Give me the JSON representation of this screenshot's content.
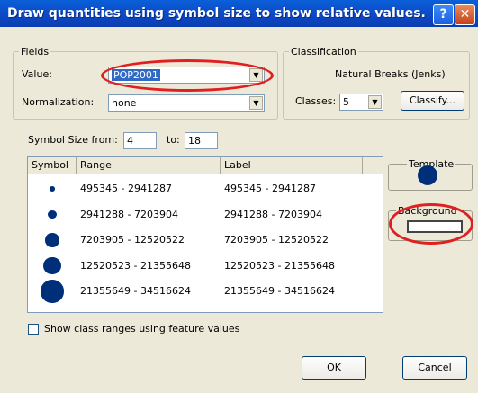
{
  "window": {
    "title": "Draw quantities using symbol size to show relative values.",
    "help_label": "?",
    "close_label": "✕"
  },
  "fields": {
    "legend": "Fields",
    "value_label": "Value:",
    "value_selected": "POP2001",
    "normalization_label": "Normalization:",
    "normalization_selected": "none"
  },
  "classification": {
    "legend": "Classification",
    "method": "Natural Breaks (Jenks)",
    "classes_label": "Classes:",
    "classes_value": "5",
    "classify_button": "Classify..."
  },
  "symbol_size": {
    "from_label": "Symbol Size from:",
    "from_value": "4",
    "to_label": "to:",
    "to_value": "18"
  },
  "table": {
    "columns": [
      "Symbol",
      "Range",
      "Label"
    ],
    "rows": [
      {
        "range": "495345 - 2941287",
        "label": "495345 - 2941287",
        "symbol_size": 4
      },
      {
        "range": "2941288 - 7203904",
        "label": "2941288 - 7203904",
        "symbol_size": 7
      },
      {
        "range": "7203905 - 12520522",
        "label": "7203905 - 12520522",
        "symbol_size": 11
      },
      {
        "range": "12520523 - 21355648",
        "label": "12520523 - 21355648",
        "symbol_size": 14
      },
      {
        "range": "21355649 - 34516624",
        "label": "21355649 - 34516624",
        "symbol_size": 18
      }
    ]
  },
  "template": {
    "legend": "Template"
  },
  "background": {
    "legend": "Background"
  },
  "show_class_ranges": {
    "label": "Show class ranges using feature values",
    "checked": false
  },
  "buttons": {
    "ok": "OK",
    "cancel": "Cancel"
  },
  "colors": {
    "symbol": "#002f7a",
    "titlebar": "#0d47c4",
    "highlight": "#e02020"
  }
}
